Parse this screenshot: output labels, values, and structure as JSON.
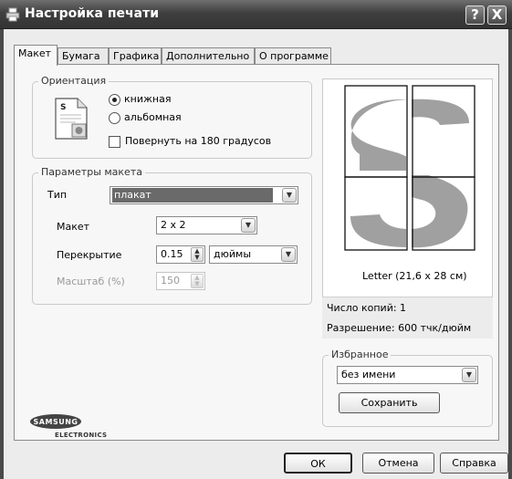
{
  "window": {
    "title": "Настройка печати",
    "help_button": "?",
    "close_button": "X"
  },
  "tabs": [
    {
      "label": "Макет",
      "active": true
    },
    {
      "label": "Бумага",
      "active": false
    },
    {
      "label": "Графика",
      "active": false
    },
    {
      "label": "Дополнительно",
      "active": false
    },
    {
      "label": "О программе",
      "active": false
    }
  ],
  "orientation": {
    "label": "Ориентация",
    "options": [
      {
        "label": "книжная",
        "selected": true
      },
      {
        "label": "альбомная",
        "selected": false
      }
    ],
    "rotate_label": "Повернуть на 180 градусов",
    "rotate_checked": false
  },
  "layout_params": {
    "label": "Параметры макета",
    "type_label": "Тип",
    "type_value": "плакат",
    "layout_label": "Макет",
    "layout_value": "2 x 2",
    "overlap_label": "Перекрытие",
    "overlap_value": "0.15",
    "units_value": "дюймы",
    "scale_label": "Масштаб (%)",
    "scale_value": "150"
  },
  "preview": {
    "paper_text": "Letter (21,6 x 28 см)",
    "copies_text": "Число копий: 1",
    "resolution_text": "Разрешение: 600 тчк/дюйм"
  },
  "favorites": {
    "label": "Избранное",
    "value": "без имени",
    "save_label": "Сохранить"
  },
  "logo": {
    "brand": "SAMSUNG",
    "sub": "ELECTRONICS"
  },
  "footer": {
    "ok": "ОК",
    "cancel": "Отмена",
    "help": "Справка"
  },
  "colors": {
    "title_bar": "#4a4a4a",
    "panel": "#f7f7f7",
    "preview_gray": "#a0a0a0",
    "selection": "#6a6a6a"
  },
  "icons": [
    "printer-icon",
    "portrait-document-icon",
    "dropdown-arrow-icon",
    "spin-arrows-icon"
  ]
}
